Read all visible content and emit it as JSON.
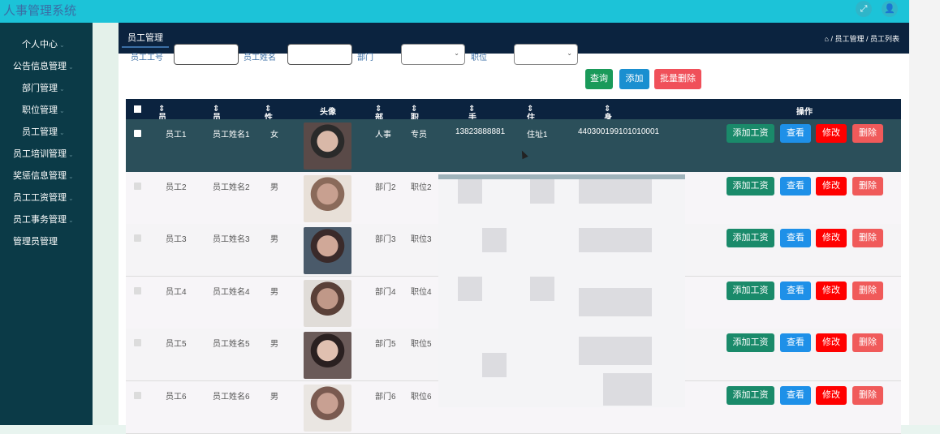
{
  "app": {
    "title": "人事管理系统"
  },
  "topbar": {
    "fullscreen_icon": "fullscreen-icon",
    "user_icon": "user-icon"
  },
  "sidebar": {
    "items": [
      {
        "label": "个人中心",
        "indent": true
      },
      {
        "label": "公告信息管理",
        "indent": false
      },
      {
        "label": "部门管理",
        "indent": true
      },
      {
        "label": "职位管理",
        "indent": true
      },
      {
        "label": "员工管理",
        "indent": true
      },
      {
        "label": "员工培训管理",
        "indent": false
      },
      {
        "label": "奖惩信息管理",
        "indent": false
      },
      {
        "label": "员工工资管理",
        "indent": false
      },
      {
        "label": "员工事务管理",
        "indent": false
      },
      {
        "label": "管理员管理",
        "indent": false,
        "no_arrow": true
      }
    ]
  },
  "header": {
    "tab": "员工管理",
    "breadcrumb": "/ 员工管理 / 员工列表"
  },
  "filters": {
    "label_id": "员工工号",
    "label_name": "员工姓名",
    "label_dept": "部门",
    "label_position": "职位",
    "btn_query": "查询",
    "btn_add": "添加",
    "btn_batch_delete": "批量删除"
  },
  "colors": {
    "query": "#1a9a5a",
    "add": "#1a8fd0",
    "batch": "#f0505a",
    "addsal": "#1a8a6a",
    "view": "#1e90e8",
    "edit": "#ff0000",
    "del": "#f05a5a"
  },
  "table": {
    "headers": [
      "员工工号",
      "员工姓名",
      "性别",
      "头像",
      "部门",
      "职位",
      "手机",
      "住址",
      "身份证",
      "操作"
    ],
    "rows": [
      {
        "id": "员工1",
        "name": "员工姓名1",
        "gender": "女",
        "dept": "人事",
        "position": "专员",
        "phone": "13823888881",
        "address": "住址1",
        "idcard": "440300199101010001"
      },
      {
        "id": "员工2",
        "name": "员工姓名2",
        "gender": "男",
        "dept": "部门2",
        "position": "职位2"
      },
      {
        "id": "员工3",
        "name": "员工姓名3",
        "gender": "男",
        "dept": "部门3",
        "position": "职位3"
      },
      {
        "id": "员工4",
        "name": "员工姓名4",
        "gender": "男",
        "dept": "部门4",
        "position": "职位4"
      },
      {
        "id": "员工5",
        "name": "员工姓名5",
        "gender": "男",
        "dept": "部门5",
        "position": "职位5"
      },
      {
        "id": "员工6",
        "name": "员工姓名6",
        "gender": "男",
        "dept": "部门6",
        "position": "职位6"
      }
    ],
    "actions": {
      "add_salary": "添加工资",
      "view": "查看",
      "edit": "修改",
      "delete": "删除"
    }
  }
}
